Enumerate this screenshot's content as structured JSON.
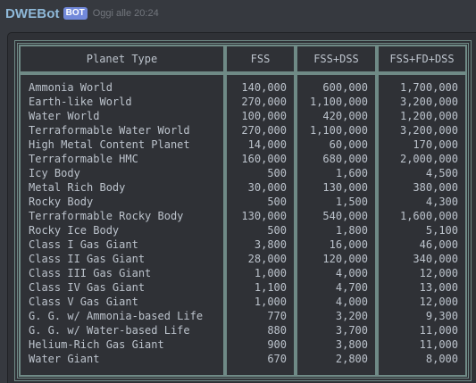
{
  "header": {
    "username": "DWEBot",
    "bot_tag": "BOT",
    "timestamp": "Oggi alle 20:24"
  },
  "table": {
    "columns": [
      "Planet Type",
      "FSS",
      "FSS+DSS",
      "FSS+FD+DSS"
    ],
    "rows": [
      [
        "Ammonia World",
        "140,000",
        "600,000",
        "1,700,000"
      ],
      [
        "Earth-like World",
        "270,000",
        "1,100,000",
        "3,200,000"
      ],
      [
        "Water World",
        "100,000",
        "420,000",
        "1,200,000"
      ],
      [
        "Terraformable Water World",
        "270,000",
        "1,100,000",
        "3,200,000"
      ],
      [
        "High Metal Content Planet",
        "14,000",
        "60,000",
        "170,000"
      ],
      [
        "Terraformable HMC",
        "160,000",
        "680,000",
        "2,000,000"
      ],
      [
        "Icy Body",
        "500",
        "1,600",
        "4,500"
      ],
      [
        "Metal Rich Body",
        "30,000",
        "130,000",
        "380,000"
      ],
      [
        "Rocky Body",
        "500",
        "1,500",
        "4,300"
      ],
      [
        "Terraformable Rocky Body",
        "130,000",
        "540,000",
        "1,600,000"
      ],
      [
        "Rocky Ice Body",
        "500",
        "1,800",
        "5,100"
      ],
      [
        "Class I Gas Giant",
        "3,800",
        "16,000",
        "46,000"
      ],
      [
        "Class II Gas Giant",
        "28,000",
        "120,000",
        "340,000"
      ],
      [
        "Class III Gas Giant",
        "1,000",
        "4,000",
        "12,000"
      ],
      [
        "Class IV Gas Giant",
        "1,100",
        "4,700",
        "13,000"
      ],
      [
        "Class V Gas Giant",
        "1,000",
        "4,000",
        "12,000"
      ],
      [
        "G. G. w/ Ammonia-based Life",
        "770",
        "3,200",
        "9,300"
      ],
      [
        "G. G. w/ Water-based Life",
        "880",
        "3,700",
        "11,000"
      ],
      [
        "Helium-Rich Gas Giant",
        "900",
        "3,800",
        "11,000"
      ],
      [
        "Water Giant",
        "670",
        "2,800",
        "8,000"
      ]
    ]
  }
}
